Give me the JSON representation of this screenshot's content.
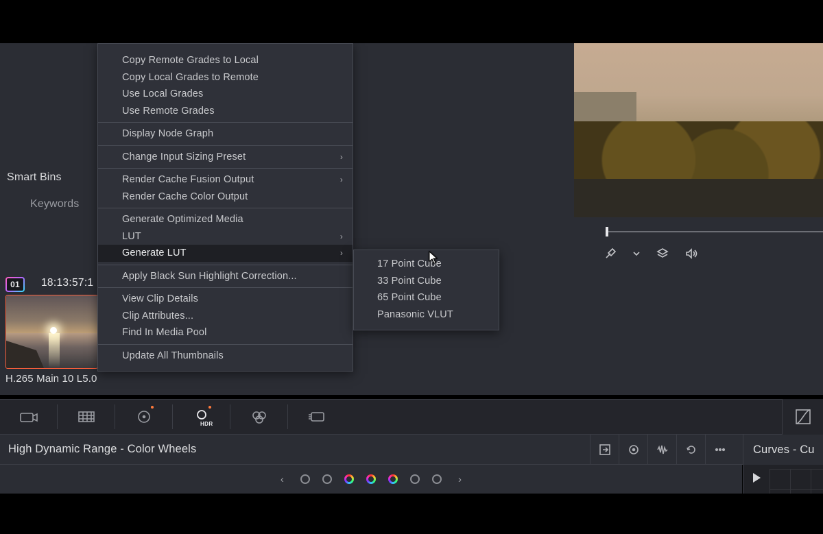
{
  "sidebar": {
    "smart_bins_label": "Smart Bins",
    "keywords_label": "Keywords"
  },
  "clip": {
    "index": "01",
    "timecode": "18:13:57:1",
    "format_label": "H.265 Main 10 L5.0"
  },
  "context_menu": {
    "items": [
      {
        "label": "Copy Remote Grades to Local",
        "submenu": false
      },
      {
        "label": "Copy Local Grades to Remote",
        "submenu": false
      },
      {
        "label": "Use Local Grades",
        "submenu": false
      },
      {
        "label": "Use Remote Grades",
        "submenu": false
      }
    ],
    "group2": [
      {
        "label": "Display Node Graph",
        "submenu": false
      }
    ],
    "group3": [
      {
        "label": "Change Input Sizing Preset",
        "submenu": true
      }
    ],
    "group4": [
      {
        "label": "Render Cache Fusion Output",
        "submenu": true
      },
      {
        "label": "Render Cache Color Output",
        "submenu": false
      }
    ],
    "group5": [
      {
        "label": "Generate Optimized Media",
        "submenu": false
      },
      {
        "label": "LUT",
        "submenu": true
      },
      {
        "label": "Generate LUT",
        "submenu": true,
        "highlight": true
      }
    ],
    "group6": [
      {
        "label": "Apply Black Sun Highlight Correction...",
        "submenu": false
      }
    ],
    "group7": [
      {
        "label": "View Clip Details",
        "submenu": false
      },
      {
        "label": "Clip Attributes...",
        "submenu": false
      },
      {
        "label": "Find In Media Pool",
        "submenu": false
      }
    ],
    "group8": [
      {
        "label": "Update All Thumbnails",
        "submenu": false
      }
    ]
  },
  "submenu": {
    "items": [
      {
        "label": "17 Point Cube"
      },
      {
        "label": "33 Point Cube"
      },
      {
        "label": "65 Point Cube"
      },
      {
        "label": "Panasonic VLUT"
      }
    ]
  },
  "viewer_toolbar": {
    "icons": [
      "picker-icon",
      "chevron-down-icon",
      "layers-icon",
      "volume-icon"
    ]
  },
  "page_toolbar": {
    "buttons": [
      {
        "name": "camera-raw-icon",
        "active": false,
        "indicator": false
      },
      {
        "name": "color-match-icon",
        "active": false,
        "indicator": false
      },
      {
        "name": "color-wheels-icon",
        "active": false,
        "indicator": true
      },
      {
        "name": "hdr-wheels-icon",
        "active": true,
        "indicator": true,
        "sublabel": "HDR"
      },
      {
        "name": "rgb-mixer-icon",
        "active": false,
        "indicator": false
      },
      {
        "name": "motion-effects-icon",
        "active": false,
        "indicator": false
      }
    ],
    "right_button": {
      "name": "curves-icon"
    }
  },
  "panel_header": {
    "title": "High Dynamic Range - Color Wheels",
    "right_icons": [
      "expand-icon",
      "target-icon",
      "waveform-icon",
      "reset-icon",
      "more-icon"
    ],
    "curves_title": "Curves - Cu"
  },
  "dots_nav": {
    "count": 7,
    "colored_indices": [
      2,
      3,
      4
    ]
  }
}
